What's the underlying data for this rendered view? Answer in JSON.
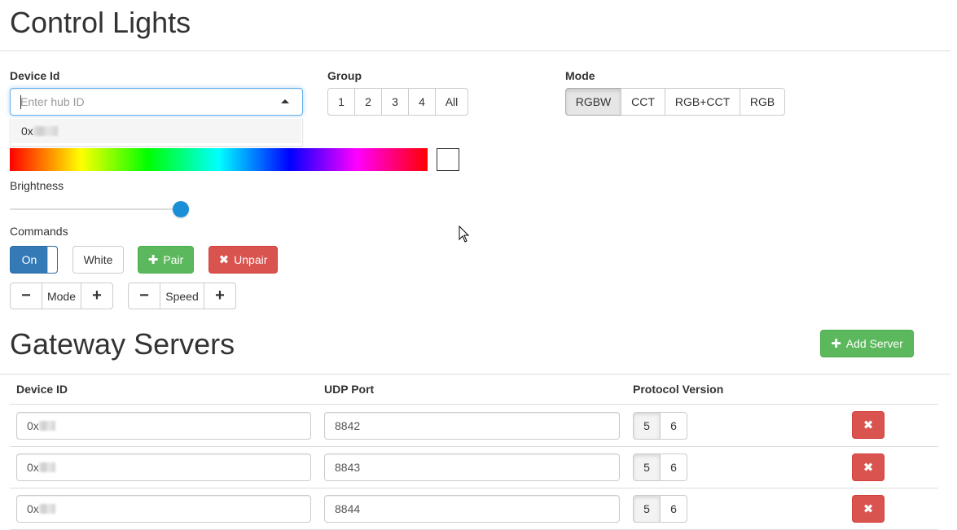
{
  "page": {
    "title": "Control Lights"
  },
  "device_id": {
    "label": "Device Id",
    "placeholder": "Enter hub ID",
    "dropdown_option_prefix": "0x"
  },
  "group": {
    "label": "Group",
    "options": [
      "1",
      "2",
      "3",
      "4",
      "All"
    ]
  },
  "mode": {
    "label": "Mode",
    "options": [
      "RGBW",
      "CCT",
      "RGB+CCT",
      "RGB"
    ],
    "selected": "RGBW"
  },
  "brightness": {
    "label": "Brightness",
    "value_fraction": 1.0
  },
  "commands": {
    "label": "Commands",
    "toggle_label": "On",
    "white_label": "White",
    "pair_label": "Pair",
    "unpair_label": "Unpair",
    "mode_stepper": {
      "minus": "−",
      "label": "Mode",
      "plus": "+"
    },
    "speed_stepper": {
      "minus": "−",
      "label": "Speed",
      "plus": "+"
    }
  },
  "gateway": {
    "title": "Gateway Servers",
    "add_label": "Add Server",
    "columns": [
      "Device ID",
      "UDP Port",
      "Protocol Version"
    ],
    "rows": [
      {
        "device_prefix": "0x",
        "port": "8842",
        "versions": [
          "5",
          "6"
        ]
      },
      {
        "device_prefix": "0x",
        "port": "8843",
        "versions": [
          "5",
          "6"
        ]
      },
      {
        "device_prefix": "0x",
        "port": "8844",
        "versions": [
          "5",
          "6"
        ]
      }
    ]
  },
  "icons": {
    "plus": "plus-icon",
    "remove": "remove-x-icon",
    "caret_up": "caret-up-icon",
    "cursor": "mouse-pointer-icon"
  },
  "colors": {
    "primary": "#337ab7",
    "success": "#5cb85c",
    "danger": "#d9534f",
    "slider": "#1a8fd8",
    "focus": "#66afe9"
  }
}
